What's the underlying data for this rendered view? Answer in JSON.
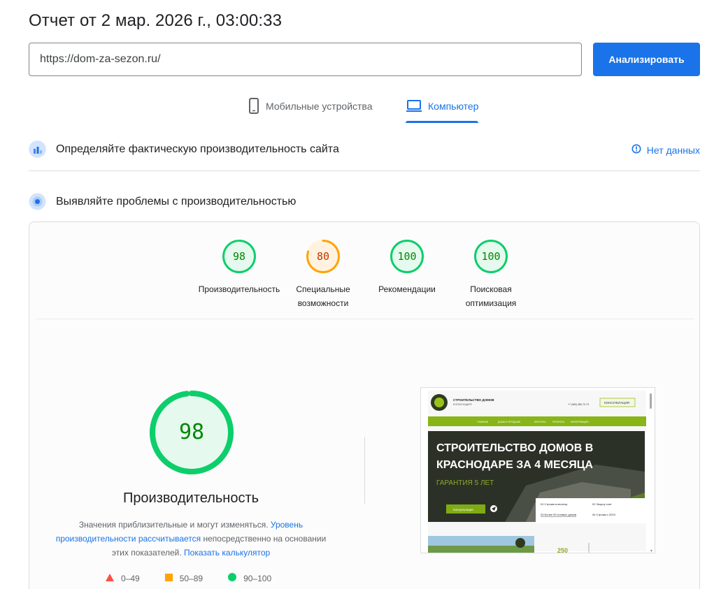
{
  "report": {
    "title": "Отчет от 2 мар. 2026 г., 03:00:33"
  },
  "search": {
    "url": "https://dom-za-sezon.ru/",
    "analyze_label": "Анализировать"
  },
  "tabs": [
    {
      "label": "Мобильные устройства",
      "icon": "phone-icon",
      "active": false
    },
    {
      "label": "Компьютер",
      "icon": "laptop-icon",
      "active": true
    }
  ],
  "field_data": {
    "title": "Определяйте фактическую производительность сайта",
    "status": "Нет данных",
    "status_icon": "info-icon"
  },
  "lab_data": {
    "title": "Выявляйте проблемы с производительностью"
  },
  "categories": [
    {
      "score": 98,
      "label": "Производительность",
      "color": "#0cce6b",
      "text_color": "#008800"
    },
    {
      "score": 80,
      "label": "Специальные возможности",
      "color": "#ffa400",
      "text_color": "#c33300"
    },
    {
      "score": 100,
      "label": "Рекомендации",
      "color": "#0cce6b",
      "text_color": "#008800"
    },
    {
      "score": 100,
      "label": "Поисковая оптимизация",
      "color": "#0cce6b",
      "text_color": "#008800"
    }
  ],
  "performance": {
    "score": 98,
    "label": "Производительность",
    "desc_start": "Значения приблизительные и могут изменяться. ",
    "desc_link1": "Уровень производительности рассчитывается",
    "desc_mid": " непосредственно на основании этих показателей. ",
    "desc_link2": "Показать калькулятор"
  },
  "legend": [
    {
      "range": "0–49",
      "shape": "triangle",
      "color": "#ff4e42"
    },
    {
      "range": "50–89",
      "shape": "square",
      "color": "#ffa400"
    },
    {
      "range": "90–100",
      "shape": "circle",
      "color": "#0cce6b"
    }
  ],
  "screenshot": {
    "brand_line1": "СТРОИТЕЛЬСТВО ДОМОВ",
    "brand_line2": "В КРАСНОДАРЕ",
    "phone": "+7 (960) 480-70-73",
    "callback_btn": "КОНСУЛЬТАЦИЯ",
    "nav": [
      "ГЛАВНАЯ",
      "ДОМА В ПРОДАЖЕ",
      "ИПОТЕКА",
      "ПРОЕКТЫ",
      "ИНФОРМАЦИЯ"
    ],
    "hero_title_1": "СТРОИТЕЛЬСТВО ДОМОВ В",
    "hero_title_2": "КРАСНОДАРЕ ЗА 4 МЕСЯЦА",
    "hero_sub": "ГАРАНТИЯ 5 ЛЕТ",
    "hero_btn": "Консультация",
    "facts": [
      "01 Строим в ипотеку",
      "02 Эскроу счет",
      "03 Более 50 готовых домов",
      "04 Строим с 2019"
    ],
    "bottom_num": "250"
  }
}
